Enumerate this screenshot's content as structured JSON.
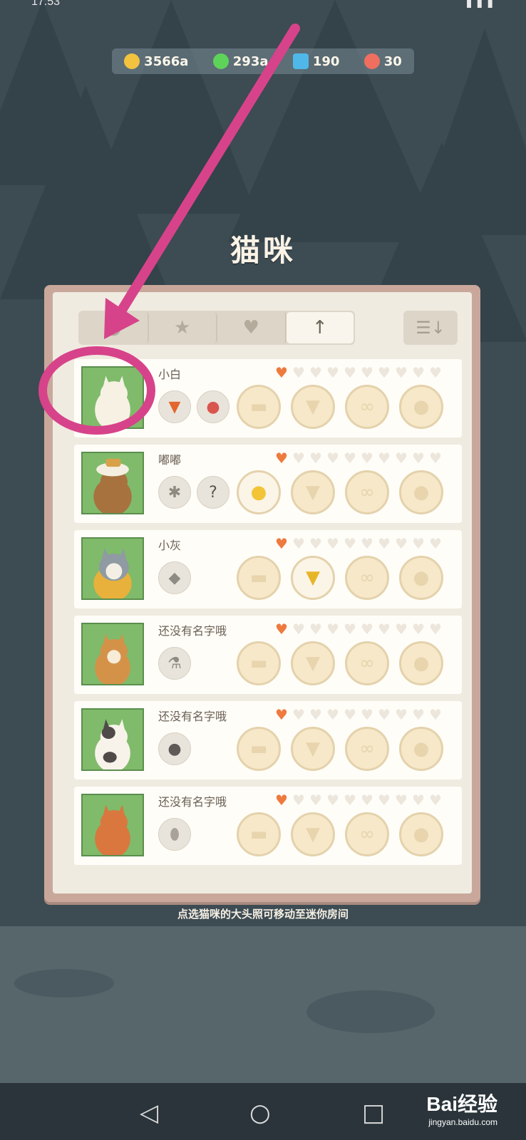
{
  "status": {
    "time": "17:53"
  },
  "resources": [
    {
      "icon": "coin-icon",
      "value": "3566a",
      "color": "#f3c23f"
    },
    {
      "icon": "leaf-icon",
      "value": "293a",
      "color": "#5ed35a"
    },
    {
      "icon": "gem-icon",
      "value": "190",
      "color": "#4fb8e8"
    },
    {
      "icon": "ticket-icon",
      "value": "30",
      "color": "#ee6f5f"
    }
  ],
  "title": "猫咪",
  "tabs": [
    {
      "name": "cat-tab",
      "icon": "cat-icon"
    },
    {
      "name": "star-tab",
      "icon": "star-icon"
    },
    {
      "name": "heart-tab",
      "icon": "heart-icon"
    },
    {
      "name": "arrow-tab",
      "icon": "up-arrow-icon",
      "active": true
    }
  ],
  "cats": [
    {
      "name": "小白",
      "hearts": 1,
      "skills": [
        "carrot-icon",
        "balloon-icon"
      ]
    },
    {
      "name": "嘟嘟",
      "hearts": 1,
      "skills": [
        "wheat-icon",
        "mystery-note-icon"
      ]
    },
    {
      "name": "小灰",
      "hearts": 1,
      "skills": [
        "corn-icon"
      ]
    },
    {
      "name": "还没有名字哦",
      "hearts": 1,
      "skills": [
        "bottle-icon"
      ]
    },
    {
      "name": "还没有名字哦",
      "hearts": 1,
      "skills": [
        "berry-icon"
      ]
    },
    {
      "name": "还没有名字哦",
      "hearts": 1,
      "skills": [
        "potato-icon"
      ]
    }
  ],
  "hint": "点选猫咪的大头照可移动至迷你房间",
  "watermark": {
    "brand": "Bai经验",
    "site": "jingyan.baidu.com"
  },
  "accent_color": "#d7438a"
}
